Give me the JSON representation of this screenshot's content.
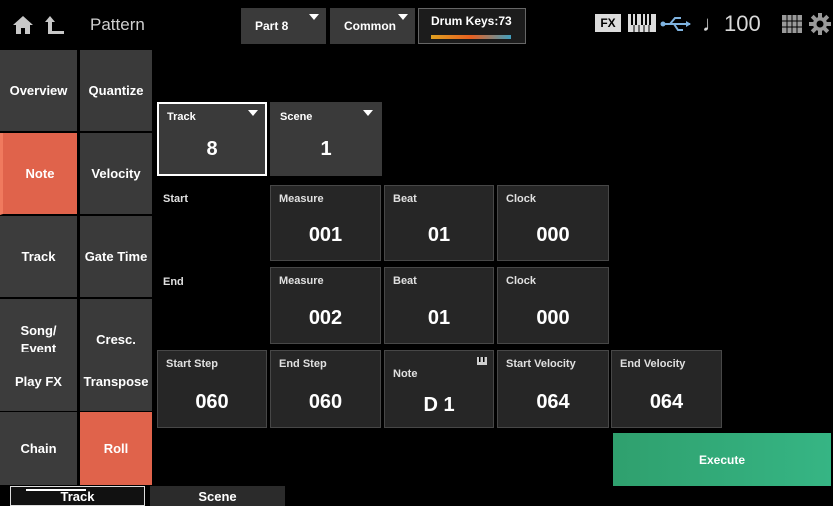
{
  "header": {
    "title": "Pattern",
    "part_button": "Part 8",
    "common_button": "Common",
    "drum_keys": "Drum Keys:73",
    "fx_badge": "FX",
    "tempo": "♩100"
  },
  "left_tabs": [
    {
      "label": "Overview"
    },
    {
      "label": "Note"
    },
    {
      "label": "Track"
    },
    {
      "label": "Song/\nEvent"
    },
    {
      "label": "Play FX"
    },
    {
      "label": "Chain"
    }
  ],
  "right_tabs": [
    {
      "label": "Quantize"
    },
    {
      "label": "Velocity"
    },
    {
      "label": "Gate Time"
    },
    {
      "label": "Cresc."
    },
    {
      "label": "Transpose"
    },
    {
      "label": "Roll"
    }
  ],
  "track": {
    "label": "Track",
    "value": "8"
  },
  "scene": {
    "label": "Scene",
    "value": "1"
  },
  "start": {
    "label": "Start",
    "measure_label": "Measure",
    "measure": "001",
    "beat_label": "Beat",
    "beat": "01",
    "clock_label": "Clock",
    "clock": "000"
  },
  "end": {
    "label": "End",
    "measure_label": "Measure",
    "measure": "002",
    "beat_label": "Beat",
    "beat": "01",
    "clock_label": "Clock",
    "clock": "000"
  },
  "start_step": {
    "label": "Start Step",
    "value": "060"
  },
  "end_step": {
    "label": "End Step",
    "value": "060"
  },
  "note": {
    "label": "Note",
    "value": "D 1"
  },
  "start_velocity": {
    "label": "Start Velocity",
    "value": "064"
  },
  "end_velocity": {
    "label": "End Velocity",
    "value": "064"
  },
  "execute_label": "Execute",
  "bottom_tabs": [
    {
      "label": "Track"
    },
    {
      "label": "Scene"
    }
  ],
  "colors": {
    "accent_tab": "#e0634b",
    "execute": "#33ad7a",
    "panel": "#262626"
  }
}
